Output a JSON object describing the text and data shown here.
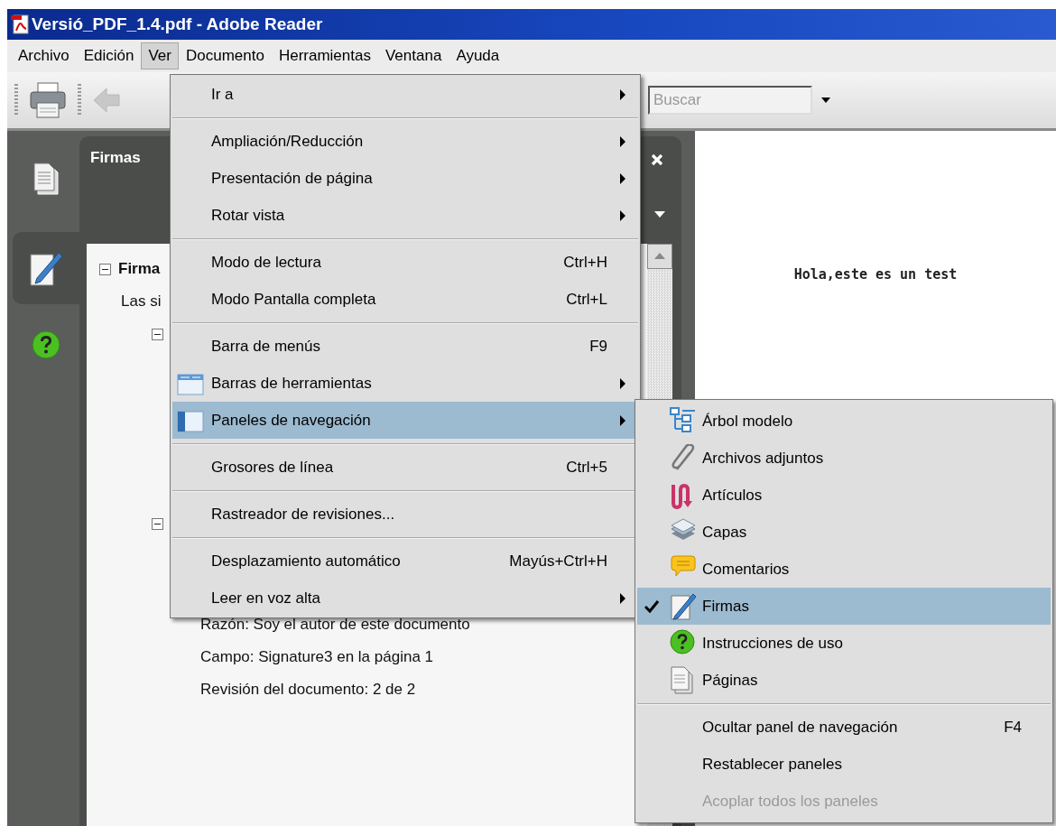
{
  "window": {
    "title": "Versió_PDF_1.4.pdf - Adobe Reader"
  },
  "menu_bar": [
    {
      "label": "Archivo",
      "selected": false
    },
    {
      "label": "Edición",
      "selected": false
    },
    {
      "label": "Ver",
      "selected": true
    },
    {
      "label": "Documento",
      "selected": false
    },
    {
      "label": "Herramientas",
      "selected": false
    },
    {
      "label": "Ventana",
      "selected": false
    },
    {
      "label": "Ayuda",
      "selected": false
    }
  ],
  "toolbar": {
    "search": {
      "placeholder": "Buscar"
    }
  },
  "nav_tabs": [
    {
      "selected": false
    },
    {
      "selected": true
    },
    {
      "selected": false
    }
  ],
  "panel": {
    "title": "Firmas",
    "rows": [
      {
        "kind": "heading",
        "text": "Firma",
        "expanded": true
      },
      {
        "kind": "text",
        "text": "Las si"
      },
      {
        "kind": "toggle",
        "expanded": true
      },
      {
        "kind": "toggle",
        "expanded": true
      },
      {
        "kind": "detail",
        "text": "Razón: Soy el autor de este documento"
      },
      {
        "kind": "detail",
        "text": "Campo: Signature3 en la página 1"
      },
      {
        "kind": "detail",
        "text": "Revisión del documento: 2 de 2"
      }
    ]
  },
  "page": {
    "text": "Hola,este es un test"
  },
  "view_menu": [
    {
      "kind": "item",
      "label": "Ir a",
      "submenu": true,
      "selected": false
    },
    {
      "kind": "separator"
    },
    {
      "kind": "item",
      "label": "Ampliación/Reducción",
      "submenu": true,
      "selected": false
    },
    {
      "kind": "item",
      "label": "Presentación de página",
      "submenu": true,
      "selected": false
    },
    {
      "kind": "item",
      "label": "Rotar vista",
      "submenu": true,
      "selected": false
    },
    {
      "kind": "separator"
    },
    {
      "kind": "item",
      "label": "Modo de lectura",
      "shortcut": "Ctrl+H",
      "submenu": false,
      "selected": false
    },
    {
      "kind": "item",
      "label": "Modo Pantalla completa",
      "shortcut": "Ctrl+L",
      "submenu": false,
      "selected": false
    },
    {
      "kind": "separator"
    },
    {
      "kind": "item",
      "label": "Barra de menús",
      "shortcut": "F9",
      "submenu": false,
      "selected": false
    },
    {
      "kind": "item",
      "label": "Barras de herramientas",
      "submenu": true,
      "selected": false
    },
    {
      "kind": "item",
      "label": "Paneles de navegación",
      "submenu": true,
      "selected": true
    },
    {
      "kind": "separator"
    },
    {
      "kind": "item",
      "label": "Grosores de línea",
      "shortcut": "Ctrl+5",
      "submenu": false,
      "selected": false
    },
    {
      "kind": "separator"
    },
    {
      "kind": "item",
      "label": "Rastreador de revisiones...",
      "submenu": false,
      "selected": false
    },
    {
      "kind": "separator"
    },
    {
      "kind": "item",
      "label": "Desplazamiento automático",
      "shortcut": "Mayús+Ctrl+H",
      "submenu": false,
      "selected": false
    },
    {
      "kind": "item",
      "label": "Leer en voz alta",
      "submenu": true,
      "selected": false
    }
  ],
  "panels_submenu": [
    {
      "kind": "item",
      "label": "Árbol modelo",
      "checked": false,
      "disabled": false,
      "selected": false
    },
    {
      "kind": "item",
      "label": "Archivos adjuntos",
      "checked": false,
      "disabled": false,
      "selected": false
    },
    {
      "kind": "item",
      "label": "Artículos",
      "checked": false,
      "disabled": false,
      "selected": false
    },
    {
      "kind": "item",
      "label": "Capas",
      "checked": false,
      "disabled": false,
      "selected": false
    },
    {
      "kind": "item",
      "label": "Comentarios",
      "checked": false,
      "disabled": false,
      "selected": false
    },
    {
      "kind": "item",
      "label": "Firmas",
      "checked": true,
      "disabled": false,
      "selected": true
    },
    {
      "kind": "item",
      "label": "Instrucciones de uso",
      "checked": false,
      "disabled": false,
      "selected": false
    },
    {
      "kind": "item",
      "label": "Páginas",
      "checked": false,
      "disabled": false,
      "selected": false
    },
    {
      "kind": "separator"
    },
    {
      "kind": "item",
      "label": "Ocultar panel de navegación",
      "shortcut": "F4",
      "checked": false,
      "disabled": false,
      "selected": false
    },
    {
      "kind": "item",
      "label": "Restablecer paneles",
      "checked": false,
      "disabled": false,
      "selected": false
    },
    {
      "kind": "item",
      "label": "Acoplar todos los paneles",
      "checked": false,
      "disabled": true,
      "selected": false
    }
  ]
}
